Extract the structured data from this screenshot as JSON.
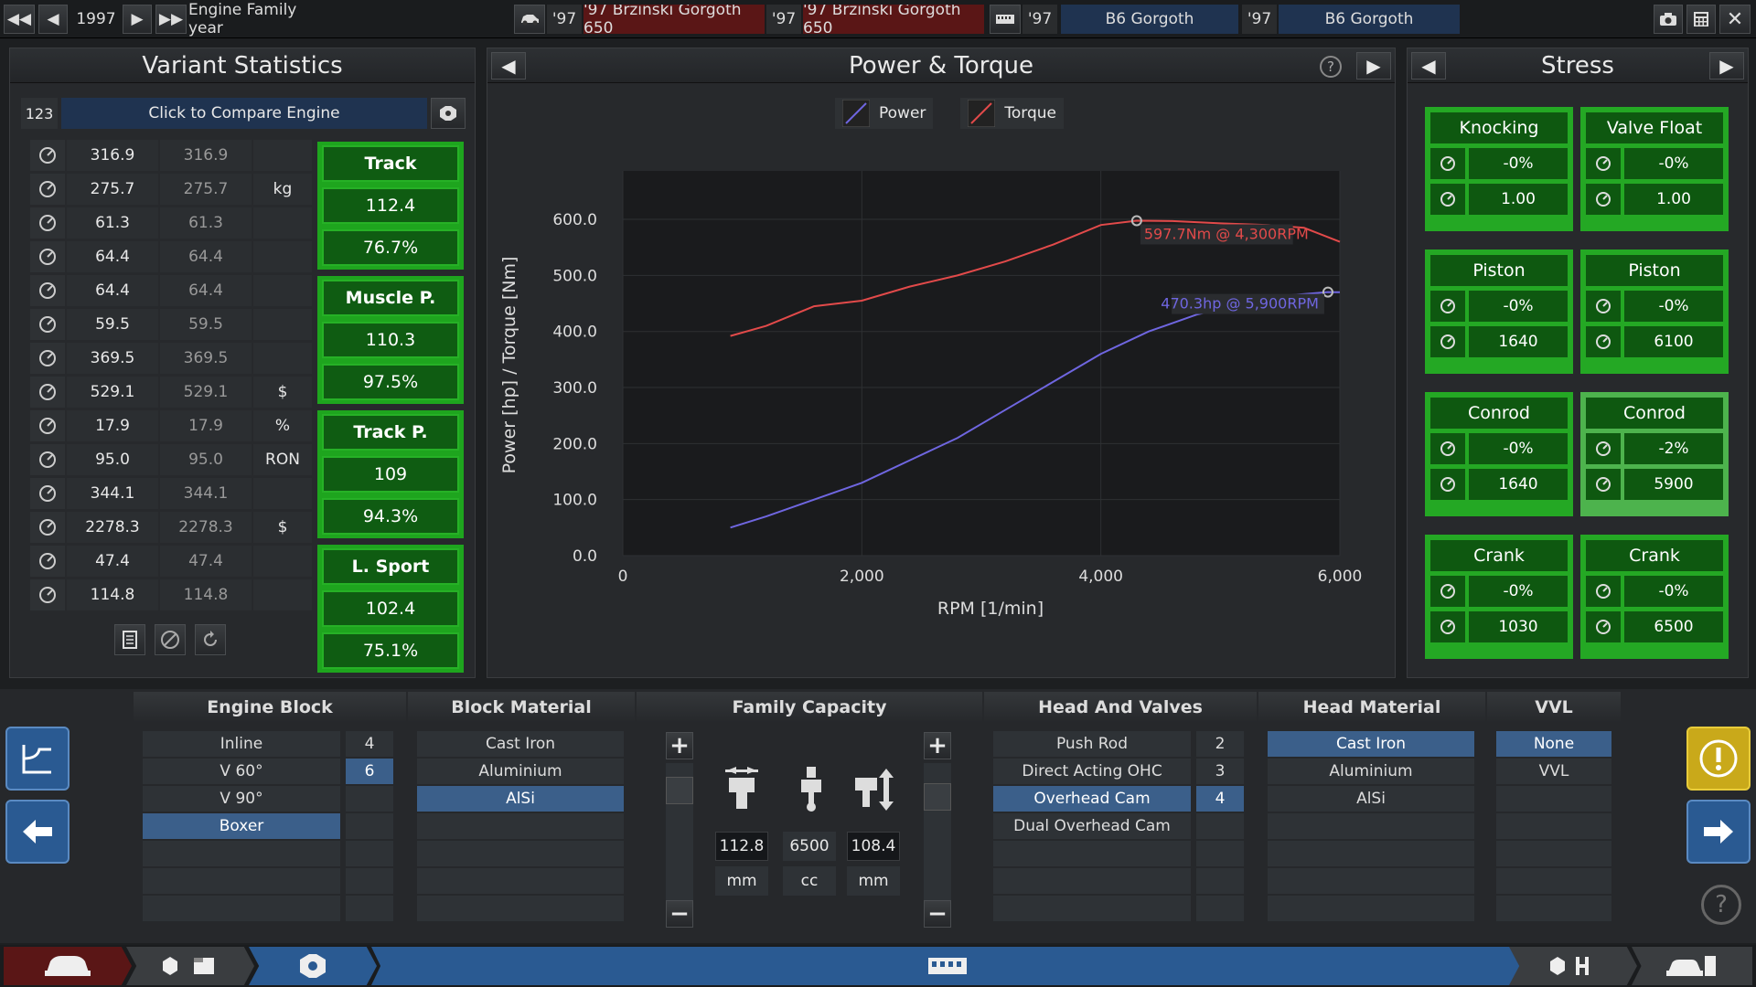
{
  "topbar": {
    "year": "1997",
    "family_label": "Engine Family year",
    "m1_year": "'97",
    "m1_name": "'97 Brzinski Gorgoth 650",
    "m2_year": "'97",
    "m2_name": "'97 Brzinski Gorgoth 650",
    "v1_year": "'97",
    "v1_name": "B6 Gorgoth",
    "v2_year": "'97",
    "v2_name": "B6 Gorgoth"
  },
  "variant": {
    "title": "Variant Statistics",
    "compare_id": "123",
    "compare_label": "Click to Compare Engine",
    "rows": [
      {
        "icon": "power-icon",
        "a": "316.9",
        "b": "316.9",
        "unit": ""
      },
      {
        "icon": "weight-icon",
        "a": "275.7",
        "b": "275.7",
        "unit": "kg"
      },
      {
        "icon": "torque-icon",
        "a": "61.3",
        "b": "61.3",
        "unit": ""
      },
      {
        "icon": "throttle-icon",
        "a": "64.4",
        "b": "64.4",
        "unit": ""
      },
      {
        "icon": "smoothness-icon",
        "a": "64.4",
        "b": "64.4",
        "unit": ""
      },
      {
        "icon": "loudness-icon",
        "a": "59.5",
        "b": "59.5",
        "unit": ""
      },
      {
        "icon": "emissions-icon",
        "a": "369.5",
        "b": "369.5",
        "unit": ""
      },
      {
        "icon": "cost-icon",
        "a": "529.1",
        "b": "529.1",
        "unit": "$"
      },
      {
        "icon": "efficiency-icon",
        "a": "17.9",
        "b": "17.9",
        "unit": "%"
      },
      {
        "icon": "fuel-icon",
        "a": "95.0",
        "b": "95.0",
        "unit": "RON"
      },
      {
        "icon": "reliability-icon",
        "a": "344.1",
        "b": "344.1",
        "unit": ""
      },
      {
        "icon": "service-cost-icon",
        "a": "2278.3",
        "b": "2278.3",
        "unit": "$"
      },
      {
        "icon": "engineering-time-icon",
        "a": "47.4",
        "b": "47.4",
        "unit": ""
      },
      {
        "icon": "tooling-icon",
        "a": "114.8",
        "b": "114.8",
        "unit": ""
      }
    ],
    "ratings": [
      {
        "name": "Track",
        "score": "112.4",
        "pct": "76.7%"
      },
      {
        "name": "Muscle P.",
        "score": "110.3",
        "pct": "97.5%"
      },
      {
        "name": "Track P.",
        "score": "109",
        "pct": "94.3%"
      },
      {
        "name": "L. Sport",
        "score": "102.4",
        "pct": "75.1%"
      }
    ]
  },
  "chart_panel": {
    "title": "Power & Torque",
    "help": "?"
  },
  "chart_data": {
    "type": "line",
    "xlabel": "RPM [1/min]",
    "ylabel": "Power [hp] / Torque [Nm]",
    "xlim": [
      0,
      6000
    ],
    "ylim": [
      0,
      650
    ],
    "xticks": [
      "0",
      "2,000",
      "4,000",
      "6,000"
    ],
    "yticks": [
      "0.0",
      "100.0",
      "200.0",
      "300.0",
      "400.0",
      "500.0",
      "600.0"
    ],
    "legend_position": "top-center",
    "series": [
      {
        "name": "Power",
        "color": "#6f66e0",
        "x": [
          900,
          1200,
          1600,
          2000,
          2400,
          2800,
          3200,
          3600,
          4000,
          4400,
          4800,
          5200,
          5600,
          5900,
          6000
        ],
        "y": [
          50,
          70,
          100,
          130,
          170,
          210,
          260,
          310,
          360,
          400,
          430,
          450,
          465,
          470.3,
          470
        ],
        "label": "470.3hp @ 5,900RPM",
        "peak_x": 5900,
        "peak_y": 470.3
      },
      {
        "name": "Torque",
        "color": "#e24a4a",
        "x": [
          900,
          1200,
          1600,
          2000,
          2400,
          2800,
          3200,
          3600,
          4000,
          4300,
          4600,
          5000,
          5400,
          5700,
          6000
        ],
        "y": [
          392,
          410,
          445,
          455,
          480,
          500,
          525,
          555,
          590,
          597.7,
          597,
          593,
          590,
          585,
          560
        ],
        "label": "597.7Nm @ 4,300RPM",
        "peak_x": 4300,
        "peak_y": 597.7
      }
    ]
  },
  "stress": {
    "title": "Stress",
    "blocks": [
      {
        "title": "Knocking",
        "v1": "-0%",
        "v2": "1.00",
        "i1": "knock-icon",
        "i2": "spark-icon"
      },
      {
        "title": "Valve Float",
        "v1": "-0%",
        "v2": "1.00",
        "i1": "knock-icon",
        "i2": "rpm-icon"
      },
      {
        "title": "Piston",
        "v1": "-0%",
        "v2": "1640",
        "i1": "knock-icon",
        "i2": "wrench-icon"
      },
      {
        "title": "Piston",
        "v1": "-0%",
        "v2": "6100",
        "i1": "knock-icon",
        "i2": "rpm-icon"
      },
      {
        "title": "Conrod",
        "v1": "-0%",
        "v2": "1640",
        "i1": "knock-icon",
        "i2": "wrench-icon"
      },
      {
        "title": "Conrod",
        "v1": "-2%",
        "v2": "5900",
        "i1": "knock-icon",
        "i2": "rpm-icon"
      },
      {
        "title": "Crank",
        "v1": "-0%",
        "v2": "1030",
        "i1": "knock-icon",
        "i2": "wrench-icon"
      },
      {
        "title": "Crank",
        "v1": "-0%",
        "v2": "6500",
        "i1": "knock-icon",
        "i2": "rpm-icon"
      }
    ]
  },
  "bottom": {
    "engine_block": {
      "title": "Engine Block",
      "options": [
        "Inline",
        "V 60°",
        "V 90°",
        "Boxer"
      ],
      "selected": "Boxer",
      "counts": [
        "4",
        "6"
      ],
      "selected_count": "6"
    },
    "block_material": {
      "title": "Block Material",
      "options": [
        "Cast Iron",
        "Aluminium",
        "AlSi"
      ],
      "selected": "AlSi"
    },
    "family_capacity": {
      "title": "Family Capacity",
      "bore": "112.8",
      "capacity": "6500",
      "stroke": "108.4",
      "bore_unit": "mm",
      "cap_unit": "cc",
      "stroke_unit": "mm",
      "plus": "+",
      "minus": "−"
    },
    "head_valves": {
      "title": "Head And Valves",
      "options": [
        "Push Rod",
        "Direct Acting OHC",
        "Overhead Cam",
        "Dual Overhead Cam"
      ],
      "selected": "Overhead Cam",
      "counts": [
        "2",
        "3",
        "4"
      ],
      "selected_count": "4"
    },
    "head_material": {
      "title": "Head Material",
      "options": [
        "Cast Iron",
        "Aluminium",
        "AlSi"
      ],
      "selected": "Cast Iron"
    },
    "vvl": {
      "title": "VVL",
      "options": [
        "None",
        "VVL"
      ],
      "selected": "None"
    }
  }
}
